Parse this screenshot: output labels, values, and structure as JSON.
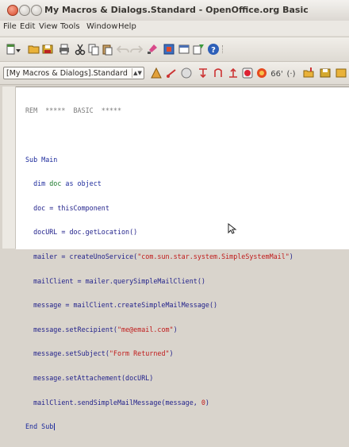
{
  "window": {
    "title": "My Macros & Dialogs.Standard - OpenOffice.org Basic"
  },
  "menu": {
    "items": [
      {
        "label": "File"
      },
      {
        "label": "Edit"
      },
      {
        "label": "View"
      },
      {
        "label": "Tools"
      },
      {
        "label": "Window"
      },
      {
        "label": "Help"
      }
    ]
  },
  "toolbar": {
    "library_selector": "[My Macros & Dialogs].Standard"
  },
  "editor": {
    "lines": {
      "l0_a": "REM  *****  BASIC  *****",
      "l2_kw1": "Sub",
      "l2_nm": " Main",
      "l3_kw1": "  dim",
      "l3_id": " doc",
      "l3_kw2": " as object",
      "l4": "  doc = thisComponent",
      "l5": "  docURL = doc.getLocation()",
      "l6_a": "  mailer = createUnoService(",
      "l6_s": "\"com.sun.star.system.SimpleSystemMail\"",
      "l6_b": ")",
      "l7": "  mailClient = mailer.querySimpleMailClient()",
      "l8": "  message = mailClient.createSimpleMailMessage()",
      "l9_a": "  message.setRecipient(",
      "l9_s": "\"me@email.com\"",
      "l9_b": ")",
      "l10_a": "  message.setSubject(",
      "l10_s": "\"Form Returned\"",
      "l10_b": ")",
      "l11": "  message.setAttachement(docURL)",
      "l12_a": "  mailClient.sendSimpleMailMessage(message, ",
      "l12_n": "0",
      "l12_b": ")",
      "l13": "End Sub"
    }
  }
}
